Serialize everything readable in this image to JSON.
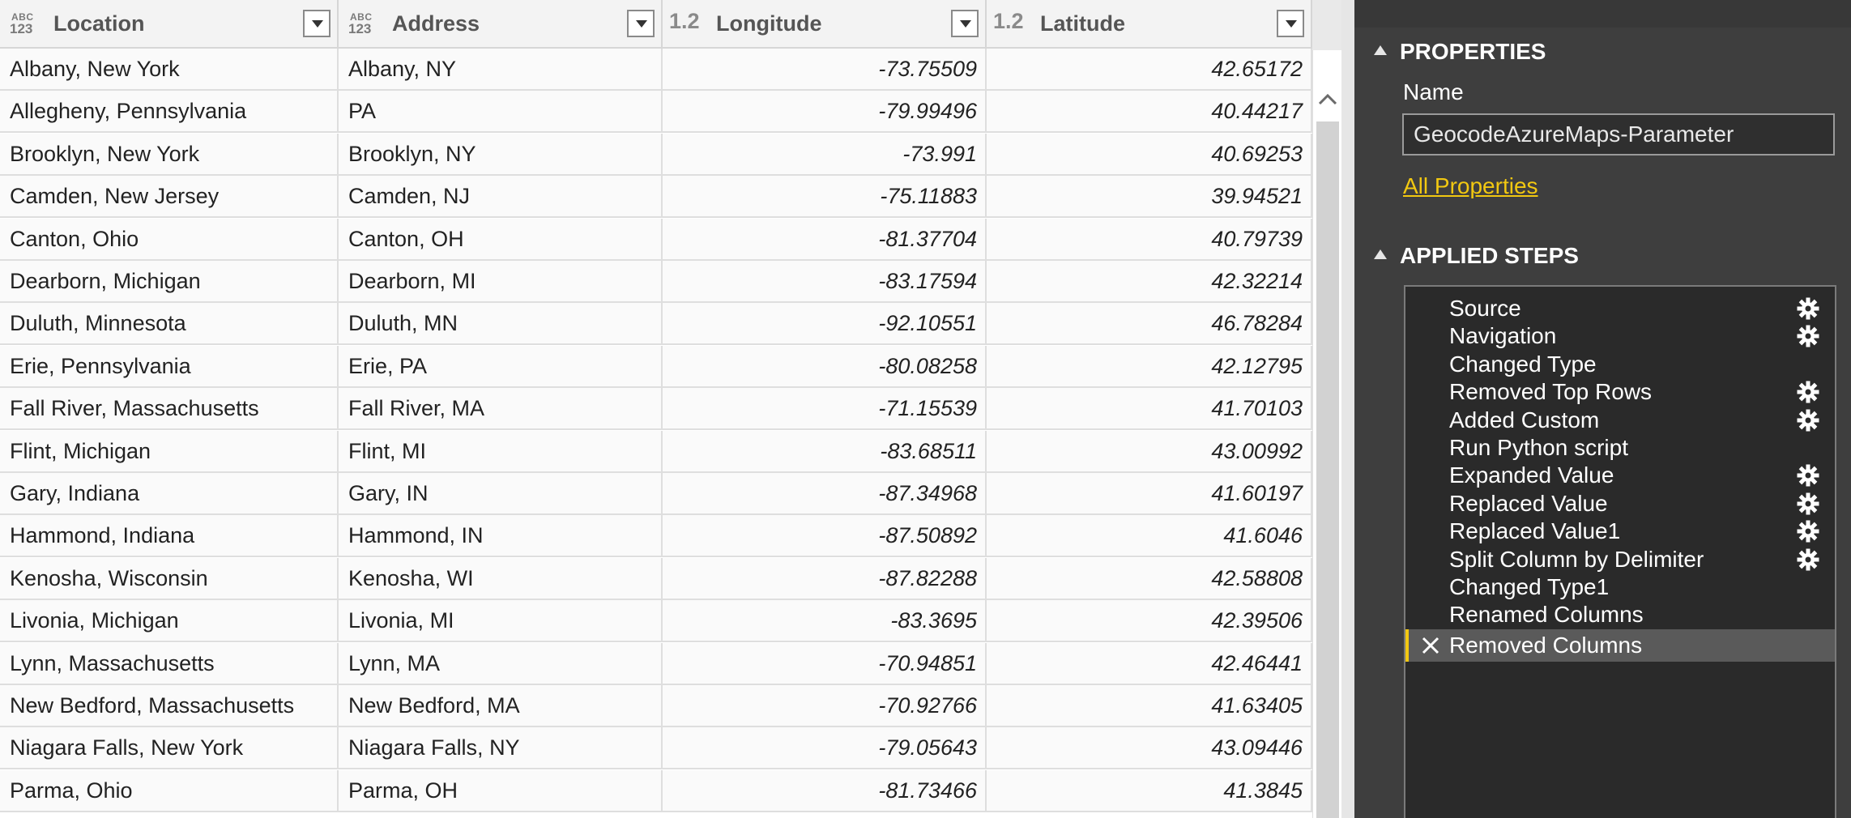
{
  "grid": {
    "columns": [
      {
        "type": "ABC/123",
        "type_top": "ABC",
        "type_bottom": "123",
        "label": "Location"
      },
      {
        "type": "ABC/123",
        "type_top": "ABC",
        "type_bottom": "123",
        "label": "Address"
      },
      {
        "type": "1.2",
        "label": "Longitude"
      },
      {
        "type": "1.2",
        "label": "Latitude"
      }
    ],
    "rows": [
      [
        "Albany, New York",
        "Albany, NY",
        "-73.75509",
        "42.65172"
      ],
      [
        "Allegheny, Pennsylvania",
        "PA",
        "-79.99496",
        "40.44217"
      ],
      [
        "Brooklyn, New York",
        "Brooklyn, NY",
        "-73.991",
        "40.69253"
      ],
      [
        "Camden, New Jersey",
        "Camden, NJ",
        "-75.11883",
        "39.94521"
      ],
      [
        "Canton, Ohio",
        "Canton, OH",
        "-81.37704",
        "40.79739"
      ],
      [
        "Dearborn, Michigan",
        "Dearborn, MI",
        "-83.17594",
        "42.32214"
      ],
      [
        "Duluth, Minnesota",
        "Duluth, MN",
        "-92.10551",
        "46.78284"
      ],
      [
        "Erie, Pennsylvania",
        "Erie, PA",
        "-80.08258",
        "42.12795"
      ],
      [
        "Fall River, Massachusetts",
        "Fall River, MA",
        "-71.15539",
        "41.70103"
      ],
      [
        "Flint, Michigan",
        "Flint, MI",
        "-83.68511",
        "43.00992"
      ],
      [
        "Gary, Indiana",
        "Gary, IN",
        "-87.34968",
        "41.60197"
      ],
      [
        "Hammond, Indiana",
        "Hammond, IN",
        "-87.50892",
        "41.6046"
      ],
      [
        "Kenosha, Wisconsin",
        "Kenosha, WI",
        "-87.82288",
        "42.58808"
      ],
      [
        "Livonia, Michigan",
        "Livonia, MI",
        "-83.3695",
        "42.39506"
      ],
      [
        "Lynn, Massachusetts",
        "Lynn, MA",
        "-70.94851",
        "42.46441"
      ],
      [
        "New Bedford, Massachusetts",
        "New Bedford, MA",
        "-70.92766",
        "41.63405"
      ],
      [
        "Niagara Falls, New York",
        "Niagara Falls, NY",
        "-79.05643",
        "43.09446"
      ],
      [
        "Parma, Ohio",
        "Parma, OH",
        "-81.73466",
        "41.3845"
      ]
    ]
  },
  "pane": {
    "properties_title": "PROPERTIES",
    "name_label": "Name",
    "name_value": "GeocodeAzureMaps-Parameter",
    "all_properties_link": "All Properties",
    "steps_title": "APPLIED STEPS",
    "steps": [
      {
        "label": "Source",
        "gear": true,
        "selected": false
      },
      {
        "label": "Navigation",
        "gear": true,
        "selected": false
      },
      {
        "label": "Changed Type",
        "gear": false,
        "selected": false
      },
      {
        "label": "Removed Top Rows",
        "gear": true,
        "selected": false
      },
      {
        "label": "Added Custom",
        "gear": true,
        "selected": false
      },
      {
        "label": "Run Python script",
        "gear": false,
        "selected": false
      },
      {
        "label": "Expanded Value",
        "gear": true,
        "selected": false
      },
      {
        "label": "Replaced Value",
        "gear": true,
        "selected": false
      },
      {
        "label": "Replaced Value1",
        "gear": true,
        "selected": false
      },
      {
        "label": "Split Column by Delimiter",
        "gear": true,
        "selected": false
      },
      {
        "label": "Changed Type1",
        "gear": false,
        "selected": false
      },
      {
        "label": "Renamed Columns",
        "gear": false,
        "selected": false
      },
      {
        "label": "Removed Columns",
        "gear": false,
        "selected": true
      }
    ]
  },
  "colors": {
    "accent": "#f2c811",
    "pane_bg": "#3e3e3e",
    "steps_bg": "#2a2a2a",
    "selected_step_bg": "#5a5a5a"
  }
}
